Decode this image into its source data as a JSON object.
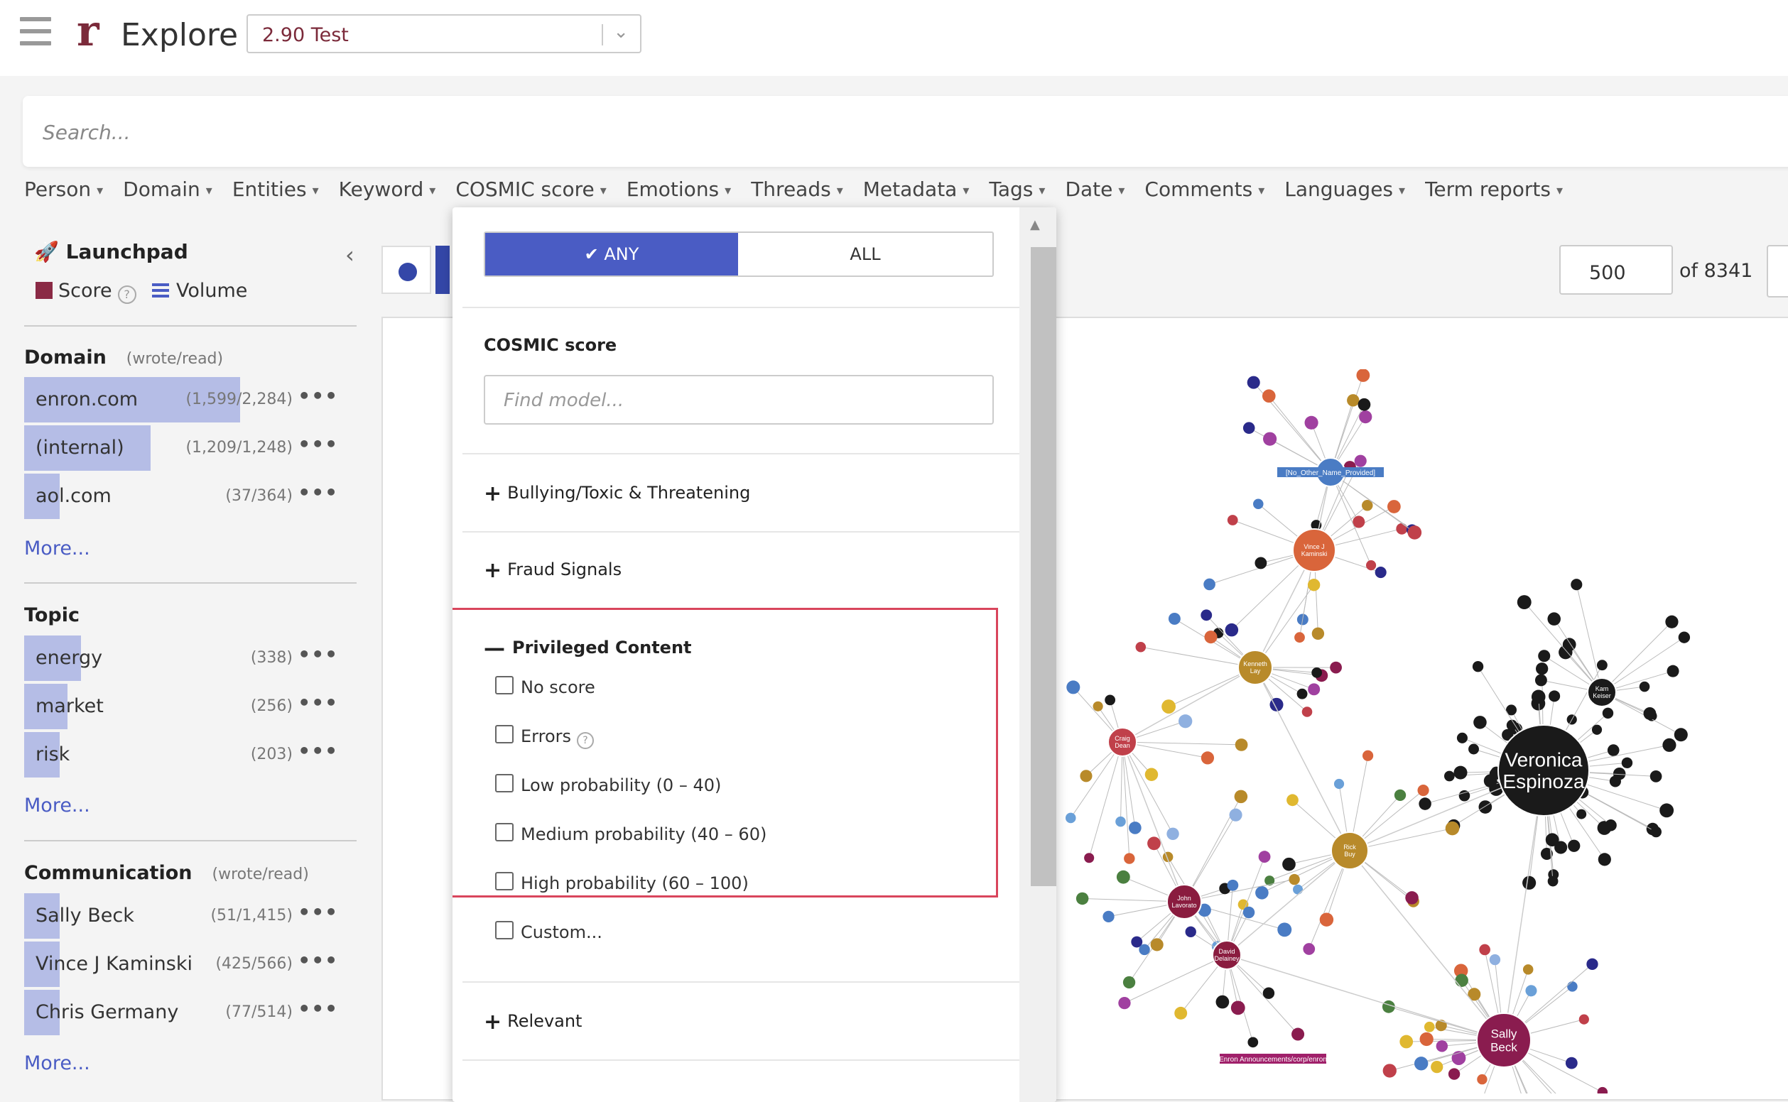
{
  "header": {
    "logo_letter": "r",
    "title": "Explore",
    "project_select": "2.90 Test"
  },
  "search": {
    "placeholder": "Search..."
  },
  "filters": [
    "Person",
    "Domain",
    "Entities",
    "Keyword",
    "COSMIC score",
    "Emotions",
    "Threads",
    "Metadata",
    "Tags",
    "Date",
    "Comments",
    "Languages",
    "Term reports"
  ],
  "sidebar": {
    "title": "Launchpad",
    "score_label": "Score",
    "volume_label": "Volume",
    "domain": {
      "title": "Domain",
      "sub": "(wrote/read)",
      "items": [
        {
          "label": "enron.com",
          "count": "(1,599/2,284)",
          "fill": 0.65
        },
        {
          "label": "(internal)",
          "count": "(1,209/1,248)",
          "fill": 0.38
        },
        {
          "label": "aol.com",
          "count": "(37/364)",
          "fill": 0.05
        }
      ],
      "more": "More..."
    },
    "topic": {
      "title": "Topic",
      "items": [
        {
          "label": "energy",
          "count": "(338)",
          "fill": 0.17
        },
        {
          "label": "market",
          "count": "(256)",
          "fill": 0.13
        },
        {
          "label": "risk",
          "count": "(203)",
          "fill": 0.1
        }
      ],
      "more": "More..."
    },
    "communication": {
      "title": "Communication",
      "sub": "(wrote/read)",
      "items": [
        {
          "label": "Sally Beck",
          "count": "(51/1,415)",
          "fill": 0.1
        },
        {
          "label": "Vince J Kaminski",
          "count": "(425/566)",
          "fill": 0.1
        },
        {
          "label": "Chris Germany",
          "count": "(77/514)",
          "fill": 0.1
        }
      ],
      "more": "More..."
    }
  },
  "pagination": {
    "page_size": "500",
    "of_total": "of 8341"
  },
  "dropdown": {
    "any_label": "ANY",
    "all_label": "ALL",
    "section_title": "COSMIC score",
    "find_placeholder": "Find model...",
    "categories": [
      "Bullying/Toxic & Threatening",
      "Fraud Signals"
    ],
    "privileged": {
      "title": "Privileged Content",
      "options": [
        "No score",
        "Errors",
        "Low probability (0 – 40)",
        "Medium probability (40 – 60)",
        "High probability (60 – 100)",
        "Custom..."
      ]
    },
    "relevant": "Relevant"
  },
  "graph": {
    "big_nodes": [
      {
        "name": "Veronica Espinoza",
        "lines": [
          "Veronica",
          "Espinoza"
        ],
        "color": "#1a1a1a"
      },
      {
        "name": "Sally Beck",
        "lines": [
          "Sally",
          "Beck"
        ],
        "color": "#8a1c4f"
      },
      {
        "name": "Vince J Kaminski",
        "lines": [
          "Vince J",
          "Kaminski"
        ],
        "color": "#d9653b"
      },
      {
        "name": "Kenneth Lay",
        "lines": [
          "Kenneth",
          "Lay"
        ],
        "color": "#b88a2a"
      },
      {
        "name": "Rick Buy",
        "lines": [
          "Rick",
          "Buy"
        ],
        "color": "#b88a2a"
      },
      {
        "name": "Craig Dean",
        "lines": [
          "Craig",
          "Dean"
        ],
        "color": "#c0404a"
      },
      {
        "name": "John Lavorato",
        "lines": [
          "John",
          "Lavorato"
        ],
        "color": "#8a1c3f"
      },
      {
        "name": "Kam Keiser",
        "lines": [
          "Kam",
          "Keiser"
        ],
        "color": "#1a1a1a"
      },
      {
        "name": "David Delainey",
        "lines": [
          "David",
          "Delainey"
        ],
        "color": "#8a1c3f"
      },
      {
        "name": "Kaminski",
        "lines": [
          "Kaminski"
        ],
        "color": "#4a7cc4"
      }
    ],
    "labels": [
      "[No_Other_Name_Provided]",
      "Enron Announcements/corp/enron"
    ]
  }
}
